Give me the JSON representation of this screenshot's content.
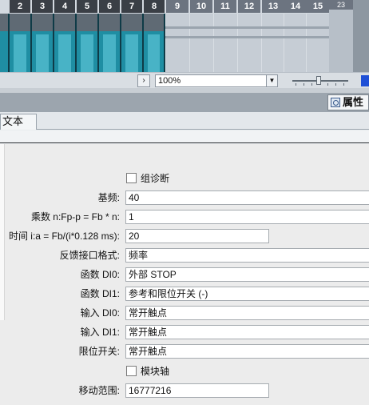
{
  "rack": {
    "slot_numbers": [
      "2",
      "3",
      "4",
      "5",
      "6",
      "7",
      "8",
      "9",
      "10",
      "11",
      "12",
      "13",
      "14",
      "15"
    ],
    "extra_slot": "23"
  },
  "toolbar": {
    "scroll_left": "›",
    "zoom_value": "100%",
    "zoom_caret": "▼"
  },
  "properties": {
    "tab_label": "属性"
  },
  "text_tab": {
    "label": "文本"
  },
  "form": {
    "diag_group_label": "组诊断",
    "base_freq_label": "基频:",
    "base_freq_value": "40",
    "multiplier_label": "乘数 n:Fp-p = Fb * n:",
    "multiplier_value": "1",
    "time_label": "时间 i:a = Fb/(i*0.128 ms):",
    "time_value": "20",
    "feedback_label": "反馈接口格式:",
    "feedback_value": "频率",
    "func_di0_label": "函数 DI0:",
    "func_di0_value": "外部 STOP",
    "func_di1_label": "函数 DI1:",
    "func_di1_value": "参考和限位开关 (-)",
    "input_di0_label": "输入 DI0:",
    "input_di0_value": "常开触点",
    "input_di1_label": "输入 DI1:",
    "input_di1_value": "常开触点",
    "limit_switch_label": "限位开关:",
    "limit_switch_value": "常开触点",
    "module_axis_label": "模块轴",
    "range_label": "移动范围:",
    "range_value": "16777216"
  }
}
